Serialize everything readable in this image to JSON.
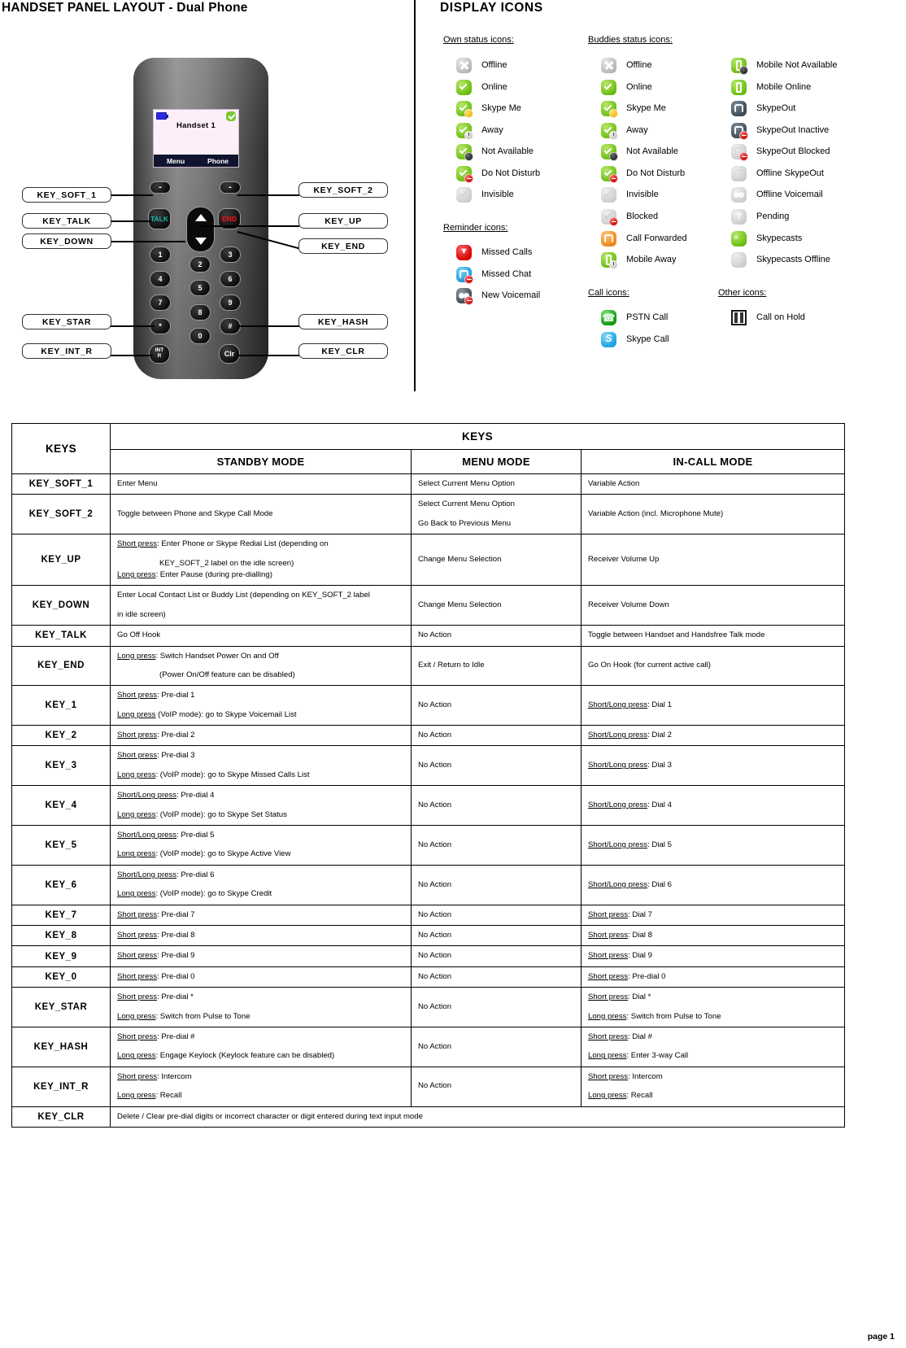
{
  "headings": {
    "left": "HANDSET PANEL LAYOUT - Dual Phone",
    "right": "DISPLAY ICONS"
  },
  "phone": {
    "screen": {
      "title": "Handset    1",
      "softkey_left": "Menu",
      "softkey_right": "Phone"
    },
    "buttons": {
      "soft1": "-",
      "soft2": "-",
      "talk": "TALK",
      "end": "END",
      "k1": "1",
      "k2": "2",
      "k3": "3",
      "k4": "4",
      "k5": "5",
      "k6": "6",
      "k7": "7",
      "k8": "8",
      "k9": "9",
      "k0": "0",
      "star": "*",
      "hash": "#",
      "clr": "Clr",
      "int_a": "INT",
      "int_b": "R"
    },
    "callouts": {
      "soft1": "KEY_SOFT_1",
      "talk": "KEY_TALK",
      "down": "KEY_DOWN",
      "star": "KEY_STAR",
      "int_r": "KEY_INT_R",
      "soft2": "KEY_SOFT_2",
      "up": "KEY_UP",
      "end": "KEY_END",
      "hash": "KEY_HASH",
      "clr": "KEY_CLR"
    }
  },
  "display_icons": {
    "groups": {
      "own": "Own status icons:",
      "buddies": "Buddies status icons:",
      "reminder": "Reminder icons:",
      "call": "Call icons:",
      "other": "Other icons:"
    },
    "own_status": [
      {
        "label": "Offline",
        "icon": "status-offline-icon"
      },
      {
        "label": "Online",
        "icon": "status-online-icon"
      },
      {
        "label": "Skype Me",
        "icon": "status-skype-me-icon"
      },
      {
        "label": "Away",
        "icon": "status-away-icon"
      },
      {
        "label": "Not Available",
        "icon": "status-not-available-icon"
      },
      {
        "label": "Do Not Disturb",
        "icon": "status-do-not-disturb-icon"
      },
      {
        "label": "Invisible",
        "icon": "status-invisible-icon"
      }
    ],
    "buddies_status": [
      {
        "label": "Offline",
        "icon": "buddy-offline-icon"
      },
      {
        "label": "Online",
        "icon": "buddy-online-icon"
      },
      {
        "label": "Skype Me",
        "icon": "buddy-skype-me-icon"
      },
      {
        "label": "Away",
        "icon": "buddy-away-icon"
      },
      {
        "label": "Not Available",
        "icon": "buddy-not-available-icon"
      },
      {
        "label": "Do Not Disturb",
        "icon": "buddy-do-not-disturb-icon"
      },
      {
        "label": "Invisible",
        "icon": "buddy-invisible-icon"
      },
      {
        "label": "Blocked",
        "icon": "buddy-blocked-icon"
      },
      {
        "label": "Call Forwarded",
        "icon": "call-forwarded-icon"
      },
      {
        "label": "Mobile Away",
        "icon": "mobile-away-icon"
      }
    ],
    "third_column": [
      {
        "label": "Mobile Not Available",
        "icon": "mobile-not-available-icon"
      },
      {
        "label": "Mobile Online",
        "icon": "mobile-online-icon"
      },
      {
        "label": "SkypeOut",
        "icon": "skypeout-icon"
      },
      {
        "label": "SkypeOut Inactive",
        "icon": "skypeout-inactive-icon"
      },
      {
        "label": "SkypeOut Blocked",
        "icon": "skypeout-blocked-icon"
      },
      {
        "label": "Offline SkypeOut",
        "icon": "offline-skypeout-icon"
      },
      {
        "label": "Offline Voicemail",
        "icon": "offline-voicemail-icon"
      },
      {
        "label": "Pending",
        "icon": "pending-icon"
      },
      {
        "label": "Skypecasts",
        "icon": "skypecasts-icon"
      },
      {
        "label": "Skypecasts Offline",
        "icon": "skypecasts-offline-icon"
      }
    ],
    "reminder": [
      {
        "label": "Missed Calls",
        "icon": "missed-calls-icon"
      },
      {
        "label": "Missed Chat",
        "icon": "missed-chat-icon"
      },
      {
        "label": "New Voicemail",
        "icon": "new-voicemail-icon"
      }
    ],
    "call": [
      {
        "label": "PSTN Call",
        "icon": "pstn-call-icon"
      },
      {
        "label": "Skype Call",
        "icon": "skype-call-icon"
      }
    ],
    "other": [
      {
        "label": "Call on Hold",
        "icon": "call-on-hold-icon"
      }
    ]
  },
  "table": {
    "corner": "KEYS",
    "span_header": "KEYS",
    "modes": [
      "STANDBY MODE",
      "MENU MODE",
      "IN-CALL MODE"
    ],
    "rows": [
      {
        "key": "KEY_SOFT_1",
        "standby": [
          {
            "text": "Enter Menu"
          }
        ],
        "menu": [
          {
            "text": "Select Current Menu Option"
          }
        ],
        "incall": [
          {
            "text": "Variable Action"
          }
        ]
      },
      {
        "key": "KEY_SOFT_2",
        "standby": [
          {
            "text": "Toggle between Phone and Skype Call Mode"
          }
        ],
        "menu": [
          {
            "text": "Select Current Menu Option"
          },
          {
            "text": "Go Back to Previous Menu"
          }
        ],
        "incall": [
          {
            "text": "Variable Action (incl. Microphone Mute)"
          }
        ]
      },
      {
        "key": "KEY_UP",
        "standby": [
          {
            "prefix": "Short press",
            "text": ": Enter Phone or Skype Redial List (depending on"
          },
          {
            "indent": "KEY_SOFT_2 label on the idle screen)"
          },
          {
            "prefix": "Long press",
            "text": ": Enter Pause (during pre-dialling)"
          }
        ],
        "menu": [
          {
            "text": "Change Menu Selection"
          }
        ],
        "incall": [
          {
            "text": "Receiver Volume Up"
          }
        ]
      },
      {
        "key": "KEY_DOWN",
        "standby": [
          {
            "text": "Enter Local Contact List or Buddy List (depending on KEY_SOFT_2 label"
          },
          {
            "text": "in idle screen)"
          }
        ],
        "menu": [
          {
            "text": "Change Menu Selection"
          }
        ],
        "incall": [
          {
            "text": "Receiver Volume Down"
          }
        ]
      },
      {
        "key": "KEY_TALK",
        "standby": [
          {
            "text": "Go Off Hook"
          }
        ],
        "menu": [
          {
            "text": "No Action"
          }
        ],
        "incall": [
          {
            "text": "Toggle between Handset and Handsfree Talk mode"
          }
        ]
      },
      {
        "key": "KEY_END",
        "standby": [
          {
            "prefix": "Long press",
            "text": ": Switch Handset Power On and Off"
          },
          {
            "indent": "(Power On/Off feature can be disabled)"
          }
        ],
        "menu": [
          {
            "text": "Exit / Return to Idle"
          }
        ],
        "incall": [
          {
            "text": "Go On Hook (for current active call)"
          }
        ]
      },
      {
        "key": "KEY_1",
        "standby": [
          {
            "prefix": "Short press",
            "text": ": Pre-dial 1"
          },
          {
            "prefix": "Long press",
            "text": " (VoIP mode): go to Skype Voicemail List"
          }
        ],
        "menu": [
          {
            "text": "No Action"
          }
        ],
        "incall": [
          {
            "prefix": "Short/Long press",
            "text": ": Dial 1"
          }
        ]
      },
      {
        "key": "KEY_2",
        "standby": [
          {
            "prefix": "Short press",
            "text": ": Pre-dial 2"
          }
        ],
        "menu": [
          {
            "text": "No Action"
          }
        ],
        "incall": [
          {
            "prefix": "Short/Long press",
            "text": ": Dial 2"
          }
        ]
      },
      {
        "key": "KEY_3",
        "standby": [
          {
            "prefix": "Short press",
            "text": ": Pre-dial 3"
          },
          {
            "prefix": "Long press",
            "text": ": (VoIP mode): go to Skype Missed Calls List"
          }
        ],
        "menu": [
          {
            "text": "No Action"
          }
        ],
        "incall": [
          {
            "prefix": "Short/Long press",
            "text": ": Dial 3"
          }
        ]
      },
      {
        "key": "KEY_4",
        "standby": [
          {
            "prefix": "Short/Long press",
            "text": ": Pre-dial 4"
          },
          {
            "prefix": "Long press",
            "text": ": (VoIP mode): go to Skype Set Status"
          }
        ],
        "menu": [
          {
            "text": "No Action"
          }
        ],
        "incall": [
          {
            "prefix": "Short/Long press",
            "text": ": Dial 4"
          }
        ]
      },
      {
        "key": "KEY_5",
        "standby": [
          {
            "prefix": "Short/Long press",
            "text": ": Pre-dial 5"
          },
          {
            "prefix": "Long press",
            "text": ": (VoIP mode): go to Skype Active View"
          }
        ],
        "menu": [
          {
            "text": "No Action"
          }
        ],
        "incall": [
          {
            "prefix": "Short/Long press",
            "text": ": Dial 5"
          }
        ]
      },
      {
        "key": "KEY_6",
        "standby": [
          {
            "prefix": "Short/Long press",
            "text": ": Pre-dial 6"
          },
          {
            "prefix": "Long press",
            "text": ": (VoIP mode): go to Skype Credit"
          }
        ],
        "menu": [
          {
            "text": "No Action"
          }
        ],
        "incall": [
          {
            "prefix": "Short/Long press",
            "text": ": Dial 6"
          }
        ]
      },
      {
        "key": "KEY_7",
        "standby": [
          {
            "prefix": "Short press",
            "text": ": Pre-dial 7"
          }
        ],
        "menu": [
          {
            "text": "No Action"
          }
        ],
        "incall": [
          {
            "prefix": "Short press",
            "text": ": Dial 7"
          }
        ]
      },
      {
        "key": "KEY_8",
        "standby": [
          {
            "prefix": "Short press",
            "text": ": Pre-dial 8"
          }
        ],
        "menu": [
          {
            "text": "No Action"
          }
        ],
        "incall": [
          {
            "prefix": "Short press",
            "text": ": Dial 8"
          }
        ]
      },
      {
        "key": "KEY_9",
        "standby": [
          {
            "prefix": "Short press",
            "text": ": Pre-dial 9"
          }
        ],
        "menu": [
          {
            "text": "No Action"
          }
        ],
        "incall": [
          {
            "prefix": "Short press",
            "text": ": Dial 9"
          }
        ]
      },
      {
        "key": "KEY_0",
        "standby": [
          {
            "prefix": "Short press",
            "text": ": Pre-dial 0"
          }
        ],
        "menu": [
          {
            "text": "No Action"
          }
        ],
        "incall": [
          {
            "prefix": "Short press",
            "text": ": Pre-dial 0"
          }
        ]
      },
      {
        "key": "KEY_STAR",
        "standby": [
          {
            "prefix": "Short press",
            "text": ": Pre-dial *"
          },
          {
            "prefix": "Long press",
            "text": ": Switch from Pulse to Tone"
          }
        ],
        "menu": [
          {
            "text": "No Action"
          }
        ],
        "incall": [
          {
            "prefix": "Short press",
            "text": ": Dial *"
          },
          {
            "prefix": "Long press",
            "text": ": Switch from Pulse to Tone"
          }
        ]
      },
      {
        "key": "KEY_HASH",
        "standby": [
          {
            "prefix": "Short press",
            "text": ": Pre-dial #"
          },
          {
            "prefix": "Long press",
            "text": ": Engage Keylock (Keylock feature can be disabled)"
          }
        ],
        "menu": [
          {
            "text": "No Action"
          }
        ],
        "incall": [
          {
            "prefix": "Short press",
            "text": ": Dial #"
          },
          {
            "prefix": "Long press",
            "text": ": Enter 3-way Call"
          }
        ]
      },
      {
        "key": "KEY_INT_R",
        "standby": [
          {
            "prefix": "Short press",
            "text": ": Intercom"
          },
          {
            "prefix": "Long press",
            "text": ": Recall"
          }
        ],
        "menu": [
          {
            "text": "No Action"
          }
        ],
        "incall": [
          {
            "prefix": "Short press",
            "text": ": Intercom"
          },
          {
            "prefix": "Long press",
            "text": ": Recall"
          }
        ]
      },
      {
        "key": "KEY_CLR",
        "full": "Delete / Clear pre-dial digits or incorrect character or digit entered during text input mode"
      }
    ]
  },
  "footer": "page 1"
}
